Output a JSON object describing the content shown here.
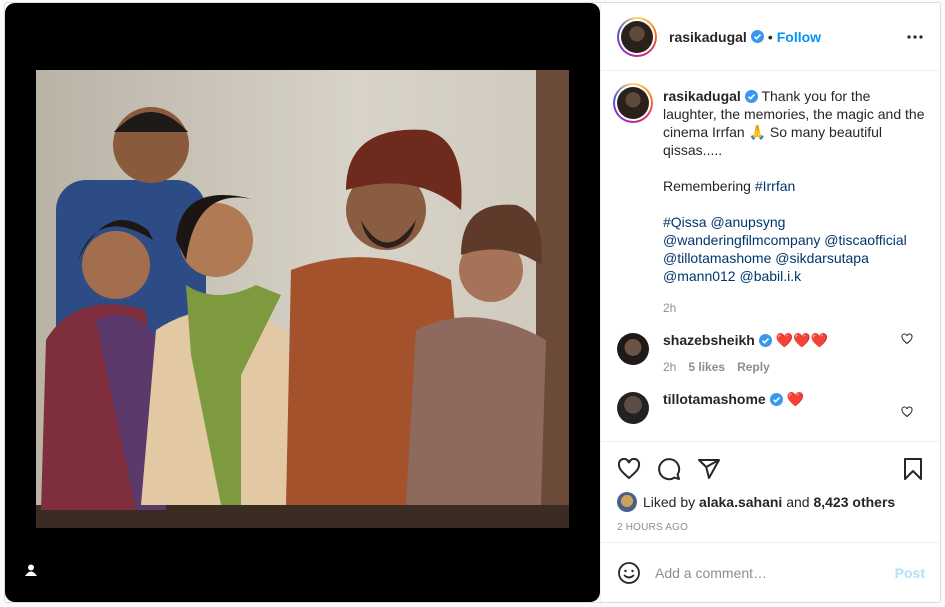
{
  "post": {
    "author": "rasikadugal",
    "follow_label": "Follow",
    "separator": "•",
    "icons": {
      "verified": "verified-badge-icon",
      "more": "more-options-icon",
      "tag": "user-tag-icon",
      "like": "heart-icon",
      "comment": "comment-icon",
      "share": "paper-plane-icon",
      "save": "bookmark-icon",
      "emoji": "emoji-icon"
    },
    "colors": {
      "accent": "#0095f6",
      "muted": "#8e8e8e",
      "link": "#00376b",
      "post_disabled": "#b2dffc"
    }
  },
  "caption": {
    "username": "rasikadugal",
    "text_line1": "Thank you for the laughter, the memories, the magic and the cinema Irrfan 🙏 So many beautiful qissas.....",
    "text_line2_prefix": "Remembering ",
    "hashtag_irrfan": "#Irrfan",
    "tags": [
      "#Qissa",
      "@anupsyng",
      "@wanderingfilmcompany",
      "@tiscaofficial",
      "@tillotamashome",
      "@sikdarsutapa",
      "@mann012",
      "@babil.i.k"
    ],
    "time": "2h"
  },
  "comments": [
    {
      "username": "shazebsheikh",
      "text": "❤️❤️❤️",
      "time": "2h",
      "likes": "5 likes",
      "reply": "Reply"
    },
    {
      "username": "tillotamashome",
      "text": "❤️"
    }
  ],
  "likes": {
    "prefix": "Liked by ",
    "user": "alaka.sahani",
    "middle": " and ",
    "others": "8,423 others"
  },
  "timestamp": "2 HOURS AGO",
  "add_comment": {
    "placeholder": "Add a comment…",
    "post_label": "Post"
  }
}
